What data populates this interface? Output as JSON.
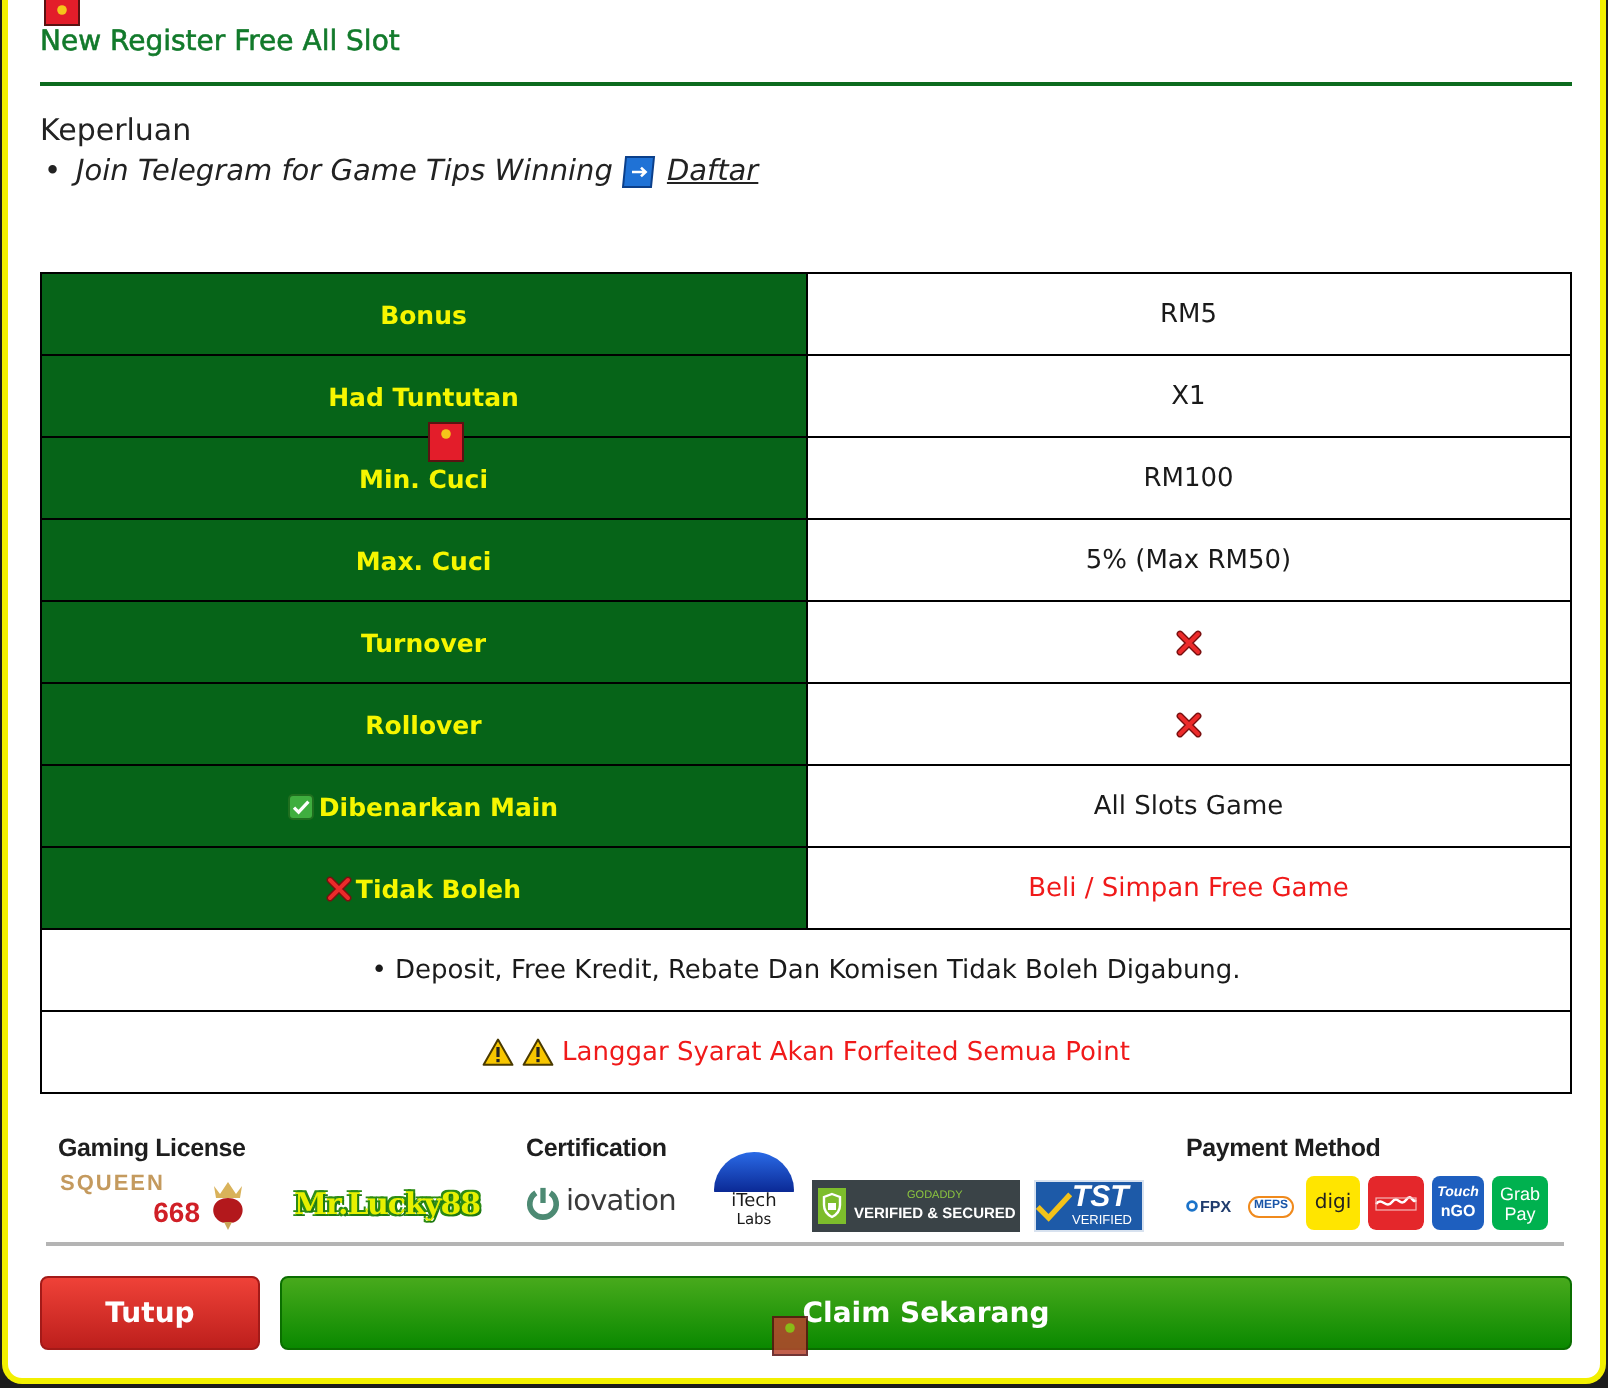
{
  "title": "New Register Free All Slot",
  "requirements": {
    "heading": "Keperluan",
    "items": [
      {
        "bullet": "•",
        "text": "Join Telegram for Game Tips Winning",
        "link": "Daftar"
      }
    ]
  },
  "table": {
    "rows": [
      {
        "kind": "text",
        "label": "Bonus",
        "value": "RM5"
      },
      {
        "kind": "text",
        "label": "Had Tuntutan",
        "value": "X1"
      },
      {
        "kind": "text",
        "label": "Min. Cuci",
        "value": "RM100"
      },
      {
        "kind": "text",
        "label": "Max. Cuci",
        "value": "5% (Max RM50)"
      },
      {
        "kind": "cross",
        "label": "Turnover"
      },
      {
        "kind": "cross",
        "label": "Rollover"
      },
      {
        "kind": "allowed",
        "label": "Dibenarkan Main",
        "value": "All Slots Game"
      },
      {
        "kind": "forbidden",
        "label": "Tidak Boleh",
        "value": "Beli / Simpan Free Game"
      }
    ],
    "notes": [
      {
        "kind": "note",
        "text": "• Deposit, Free Kredit, Rebate Dan Komisen Tidak Boleh Digabung."
      },
      {
        "kind": "warning",
        "text": "Langgar Syarat Akan Forfeited Semua Point"
      }
    ]
  },
  "footer": {
    "sections": [
      {
        "heading": "Gaming License",
        "logos": [
          {
            "kind": "squeen",
            "lines": [
              "SQUEEN",
              "668"
            ]
          },
          {
            "kind": "mrlucky",
            "lines": [
              "Mr.Lucky88"
            ]
          }
        ]
      },
      {
        "heading": "Certification",
        "logos": [
          {
            "kind": "iovation",
            "lines": [
              "iovation"
            ]
          },
          {
            "kind": "itech",
            "lines": [
              "iTech",
              "Labs"
            ]
          },
          {
            "kind": "godaddy",
            "lines": [
              "GODADDY",
              "VERIFIED & SECURED"
            ]
          },
          {
            "kind": "tst",
            "lines": [
              "TST",
              "VERIFIED"
            ]
          }
        ]
      },
      {
        "heading": "Payment Method",
        "logos": [
          {
            "kind": "fpx",
            "lines": [
              "FPX"
            ]
          },
          {
            "kind": "meps",
            "lines": [
              "MEPS"
            ]
          },
          {
            "kind": "digi",
            "lines": [
              "digi"
            ]
          },
          {
            "kind": "redtile"
          },
          {
            "kind": "tng",
            "lines": [
              "Touch",
              "nGO"
            ]
          },
          {
            "kind": "grabpay",
            "lines": [
              "Grab",
              "Pay"
            ]
          }
        ]
      }
    ]
  },
  "buttons": [
    {
      "kind": "close",
      "label": "Tutup"
    },
    {
      "kind": "claim",
      "label": "Claim Sekarang"
    }
  ]
}
